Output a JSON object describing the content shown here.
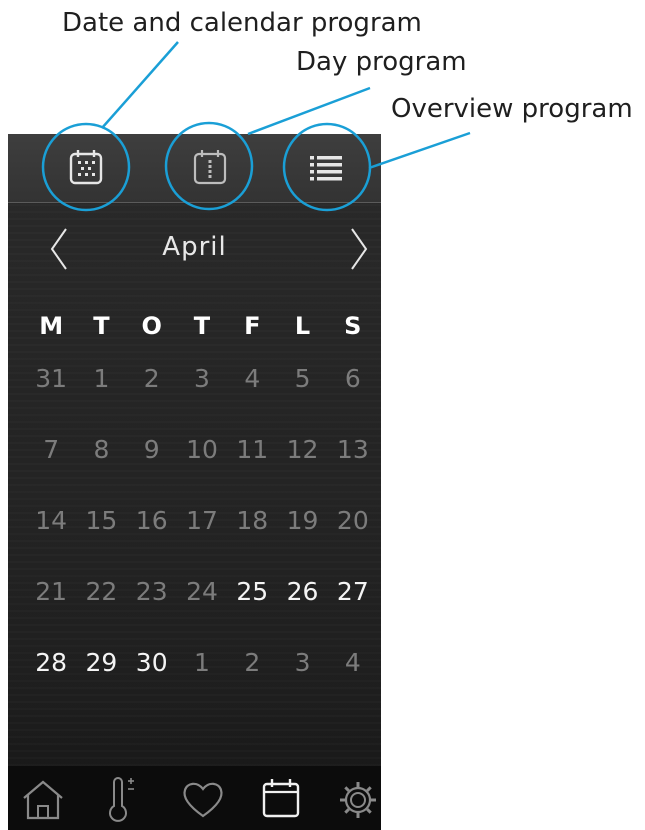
{
  "callouts": {
    "date": "Date and calendar program",
    "day": "Day program",
    "overview": "Overview program"
  },
  "topbar": {
    "icons": [
      "calendar-dots-icon",
      "day-calendar-icon",
      "list-icon"
    ]
  },
  "calendar": {
    "month": "April",
    "weekdays": [
      "M",
      "T",
      "O",
      "T",
      "F",
      "L",
      "S"
    ],
    "weeks": [
      [
        "31",
        "1",
        "2",
        "3",
        "4",
        "5",
        "6"
      ],
      [
        "7",
        "8",
        "9",
        "10",
        "11",
        "12",
        "13"
      ],
      [
        "14",
        "15",
        "16",
        "17",
        "18",
        "19",
        "20"
      ],
      [
        "21",
        "22",
        "23",
        "24",
        "25",
        "26",
        "27"
      ],
      [
        "28",
        "29",
        "30",
        "1",
        "2",
        "3",
        "4"
      ]
    ]
  },
  "bottom_nav": {
    "icons": [
      "home-icon",
      "thermometer-icon",
      "heart-icon",
      "calendar-icon",
      "gear-icon"
    ],
    "active": "calendar-icon"
  },
  "colors": {
    "callout_circle": "#1a9fd6",
    "highlight_day": "#f4f4f4",
    "dim_day": "#7c7c7c"
  }
}
